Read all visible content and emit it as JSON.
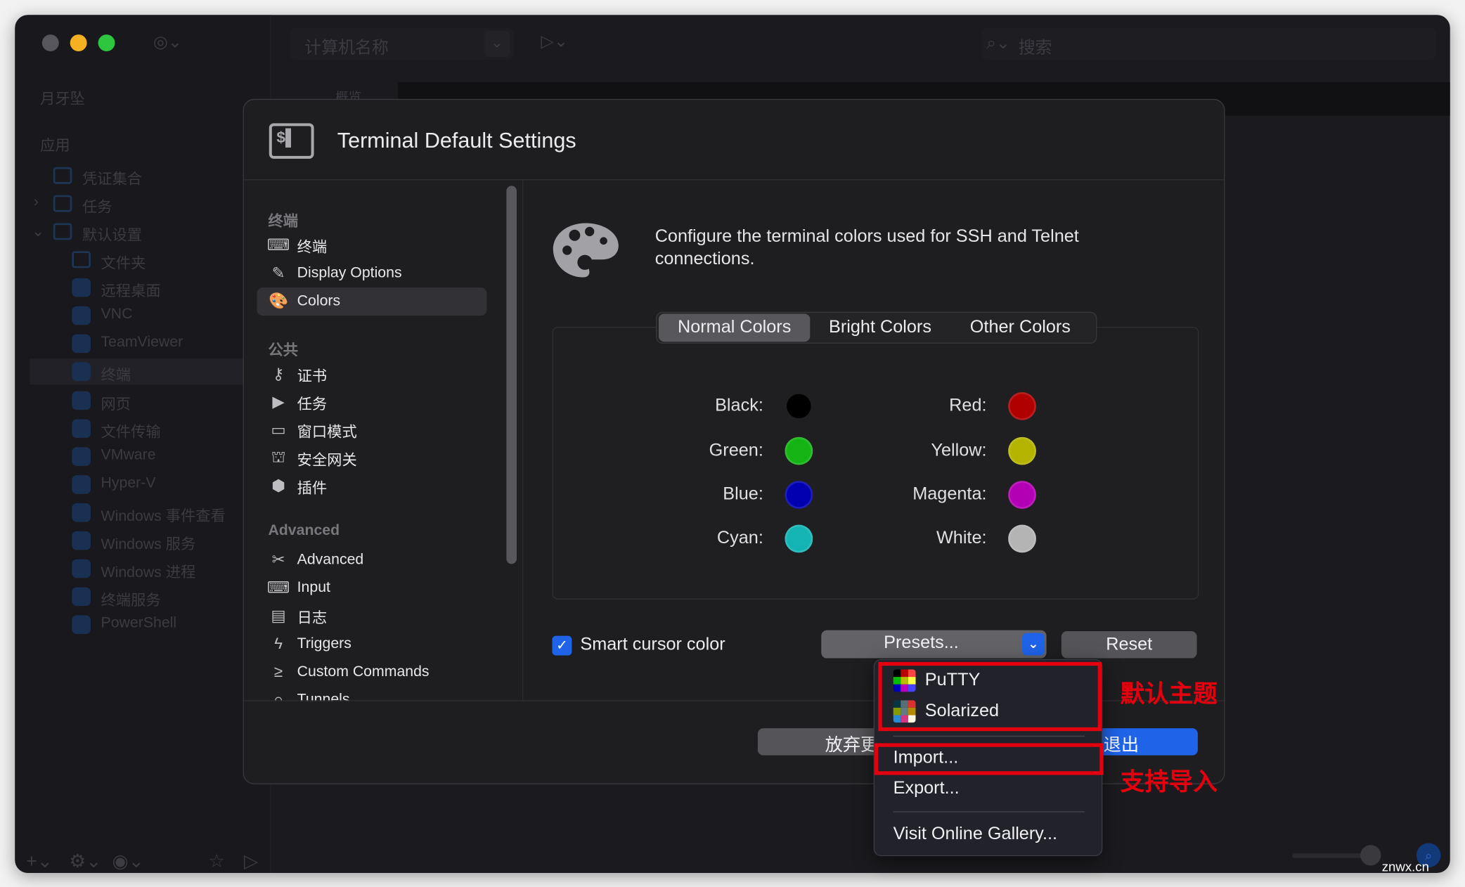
{
  "app": {
    "toolbar": {
      "computer_name_placeholder": "计算机名称",
      "search_placeholder": "搜索"
    },
    "tab": "概览",
    "sidebar": {
      "title": "月牙坠",
      "section": "应用",
      "items": [
        "凭证集合",
        "任务",
        "默认设置"
      ],
      "default_children": [
        "文件夹",
        "远程桌面",
        "VNC",
        "TeamViewer",
        "终端",
        "网页",
        "文件传输",
        "VMware",
        "Hyper-V",
        "Windows 事件查看",
        "Windows 服务",
        "Windows 进程",
        "终端服务",
        "PowerShell"
      ],
      "selected": "终端"
    },
    "watermark": "znwx.cn"
  },
  "dialog": {
    "title": "Terminal Default Settings",
    "nav": {
      "sections": [
        {
          "title": "终端",
          "items": [
            {
              "label": "终端",
              "icon": "terminal-icon"
            },
            {
              "label": "Display Options",
              "icon": "brush-icon"
            },
            {
              "label": "Colors",
              "icon": "palette-icon",
              "selected": true
            }
          ]
        },
        {
          "title": "公共",
          "items": [
            {
              "label": "证书",
              "icon": "key-icon"
            },
            {
              "label": "任务",
              "icon": "task-icon"
            },
            {
              "label": "窗口模式",
              "icon": "window-icon"
            },
            {
              "label": "安全网关",
              "icon": "gateway-icon"
            },
            {
              "label": "插件",
              "icon": "plugin-icon"
            }
          ]
        },
        {
          "title": "Advanced",
          "items": [
            {
              "label": "Advanced",
              "icon": "tools-icon"
            },
            {
              "label": "Input",
              "icon": "keyboard-icon"
            },
            {
              "label": "日志",
              "icon": "log-icon"
            },
            {
              "label": "Triggers",
              "icon": "trigger-icon"
            },
            {
              "label": "Custom Commands",
              "icon": "command-icon"
            },
            {
              "label": "Tunnels",
              "icon": "tunnel-icon"
            }
          ]
        }
      ]
    },
    "description": "Configure the terminal colors used for SSH and Telnet connections.",
    "tabs": [
      "Normal Colors",
      "Bright Colors",
      "Other Colors"
    ],
    "active_tab": "Normal Colors",
    "colors": [
      {
        "label": "Black:",
        "color": "#000000"
      },
      {
        "label": "Red:",
        "color": "#b00000"
      },
      {
        "label": "Green:",
        "color": "#14b414"
      },
      {
        "label": "Yellow:",
        "color": "#b4b400"
      },
      {
        "label": "Blue:",
        "color": "#0000b0"
      },
      {
        "label": "Magenta:",
        "color": "#b400b4"
      },
      {
        "label": "Cyan:",
        "color": "#14b4b4"
      },
      {
        "label": "White:",
        "color": "#b4b4b4"
      }
    ],
    "smart_cursor": {
      "label": "Smart cursor color",
      "checked": true
    },
    "presets_label": "Presets...",
    "reset_label": "Reset",
    "discard_label_visible": "放弃更",
    "save_label_visible": "退出",
    "accent": "#1f63e8"
  },
  "presets_menu": {
    "items": [
      "PuTTY",
      "Solarized"
    ],
    "actions": [
      "Import...",
      "Export..."
    ],
    "gallery": "Visit Online Gallery..."
  },
  "annotations": {
    "themes": "默认主题",
    "import": "支持导入",
    "color": "#e3000f"
  }
}
